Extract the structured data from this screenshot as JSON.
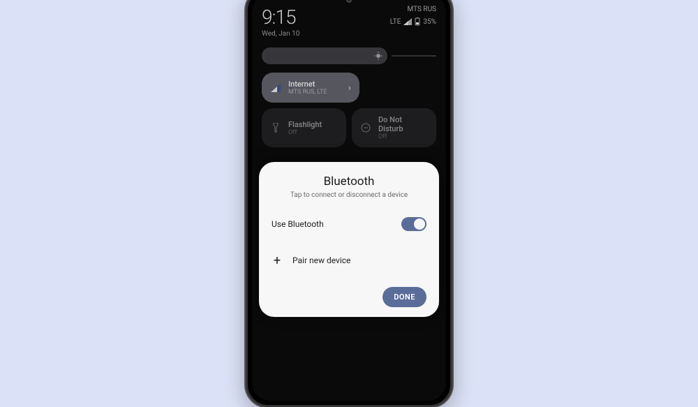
{
  "status": {
    "time": "9:15",
    "date": "Wed, Jan 10",
    "carrier": "MTS RUS",
    "network": "LTE",
    "battery": "35%"
  },
  "tiles": {
    "internet": {
      "title": "Internet",
      "subtitle": "MTS RUS, LTE"
    },
    "flashlight": {
      "title": "Flashlight",
      "subtitle": "Off"
    },
    "dnd": {
      "title": "Do Not Disturb",
      "subtitle": "Off"
    }
  },
  "sheet": {
    "title": "Bluetooth",
    "subtitle": "Tap to connect or disconnect a device",
    "use_label": "Use Bluetooth",
    "toggle_on": true,
    "pair_label": "Pair new device",
    "done_label": "DONE"
  }
}
